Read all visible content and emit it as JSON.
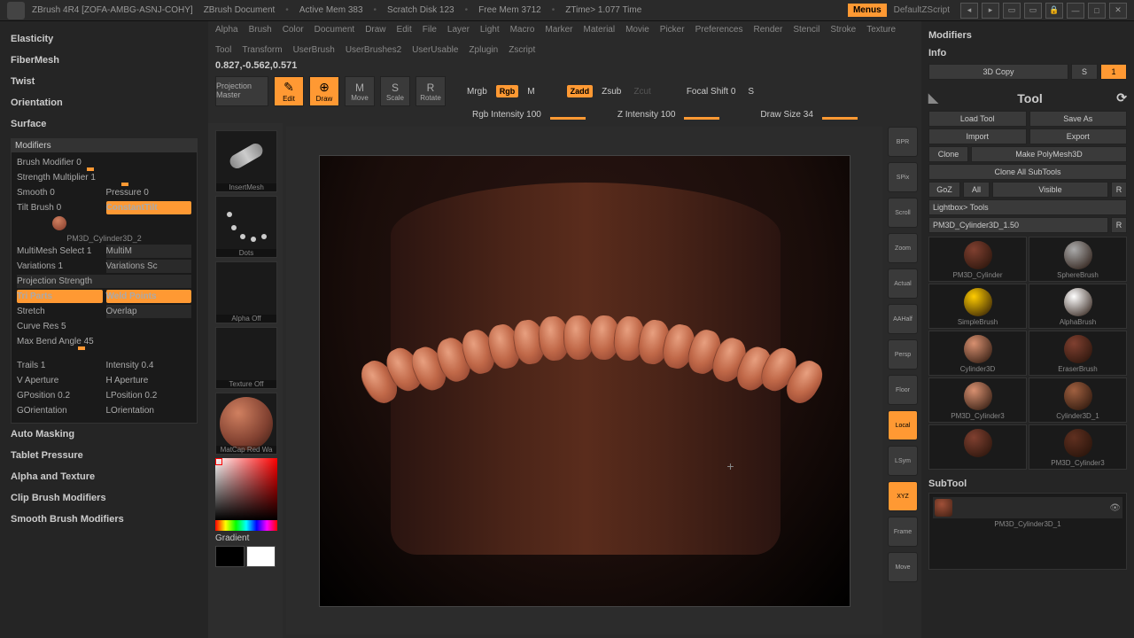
{
  "titlebar": {
    "app": "ZBrush 4R4 [ZOFA-AMBG-ASNJ-COHY]",
    "doc": "ZBrush Document",
    "mem": "Active Mem 383",
    "scratch": "Scratch Disk 123",
    "free": "Free Mem 3712",
    "ztime": "ZTime> 1.077 Time",
    "menus": "Menus",
    "script": "DefaultZScript"
  },
  "menubar": [
    "Alpha",
    "Brush",
    "Color",
    "Document",
    "Draw",
    "Edit",
    "File",
    "Layer",
    "Light",
    "Macro",
    "Marker",
    "Material",
    "Movie",
    "Picker",
    "Preferences",
    "Render",
    "Stencil",
    "Stroke",
    "Texture",
    "Tool",
    "Transform",
    "UserBrush",
    "UserBrushes2",
    "UserUsable",
    "Zplugin",
    "Zscript"
  ],
  "coords": "0.827,-0.562,0.571",
  "leftGroups": [
    "Elasticity",
    "FiberMesh",
    "Twist",
    "Orientation",
    "Surface"
  ],
  "modifiers": {
    "title": "Modifiers",
    "brushMod": "Brush Modifier 0",
    "strength": "Strength Multiplier 1",
    "smooth": "Smooth 0",
    "pressure": "Pressure 0",
    "tilt": "Tilt Brush 0",
    "constTilt": "ConstantTilt",
    "meshName": "PM3D_Cylinder3D_2",
    "multiMesh": "MultiMesh Select 1",
    "multiM": "MultiM",
    "variations": "Variations 1",
    "varSc": "Variations Sc",
    "projStr": "Projection Strength",
    "triParts": "Tri Parts",
    "weld": "Weld Points",
    "stretch": "Stretch",
    "overlap": "Overlap",
    "curveRes": "Curve Res 5",
    "maxBend": "Max Bend Angle 45",
    "trails": "Trails 1",
    "intensity": "Intensity 0.4",
    "vap": "V Aperture",
    "hap": "H Aperture",
    "gpos": "GPosition 0.2",
    "lpos": "LPosition 0.2",
    "gor": "GOrientation",
    "lor": "LOrientation"
  },
  "leftBottom": [
    "Auto Masking",
    "Tablet Pressure",
    "Alpha and Texture",
    "Clip Brush Modifiers",
    "Smooth Brush Modifiers"
  ],
  "thumbs": [
    "InsertMesh",
    "Dots",
    "Alpha Off",
    "Texture Off",
    "MatCap Red Wa",
    "Gradient"
  ],
  "toolbar": {
    "proj": "Projection Master",
    "edit": "Edit",
    "draw": "Draw",
    "move": "Move",
    "scale": "Scale",
    "rotate": "Rotate",
    "mrgb": "Mrgb",
    "rgb": "Rgb",
    "m": "M",
    "zadd": "Zadd",
    "zsub": "Zsub",
    "zcut": "Zcut",
    "focal": "Focal Shift 0",
    "s": "S",
    "rgbInt": "Rgb Intensity 100",
    "zInt": "Z Intensity 100",
    "drawSize": "Draw Size 34"
  },
  "rightTools": [
    "BPR",
    "SPix",
    "Scroll",
    "Zoom",
    "Actual",
    "AAHalf",
    "Persp",
    "Floor",
    "Local",
    "LSym",
    "XYZ",
    "Frame",
    "Move"
  ],
  "rightPanel": {
    "mod": "Modifiers",
    "info": "Info",
    "copy3d": "3D Copy",
    "s": "S",
    "one": "1",
    "tool": "Tool",
    "loadTool": "Load Tool",
    "saveAs": "Save As",
    "import": "Import",
    "export": "Export",
    "clone": "Clone",
    "makePoly": "Make PolyMesh3D",
    "cloneAll": "Clone All SubTools",
    "goz": "GoZ",
    "all": "All",
    "visible": "Visible",
    "r": "R",
    "lightbox": "Lightbox> Tools",
    "toolName": "PM3D_Cylinder3D_1.50",
    "r2": "R",
    "subtool": "SubTool",
    "stName": "PM3D_Cylinder3D_1"
  },
  "toolGrid": [
    "PM3D_Cylinder",
    "SphereBrush",
    "SimpleBrush",
    "AlphaBrush",
    "Cylinder3D",
    "EraserBrush",
    "PM3D_Cylinder3",
    "Cylinder3D_1",
    "",
    "PM3D_Cylinder3"
  ]
}
